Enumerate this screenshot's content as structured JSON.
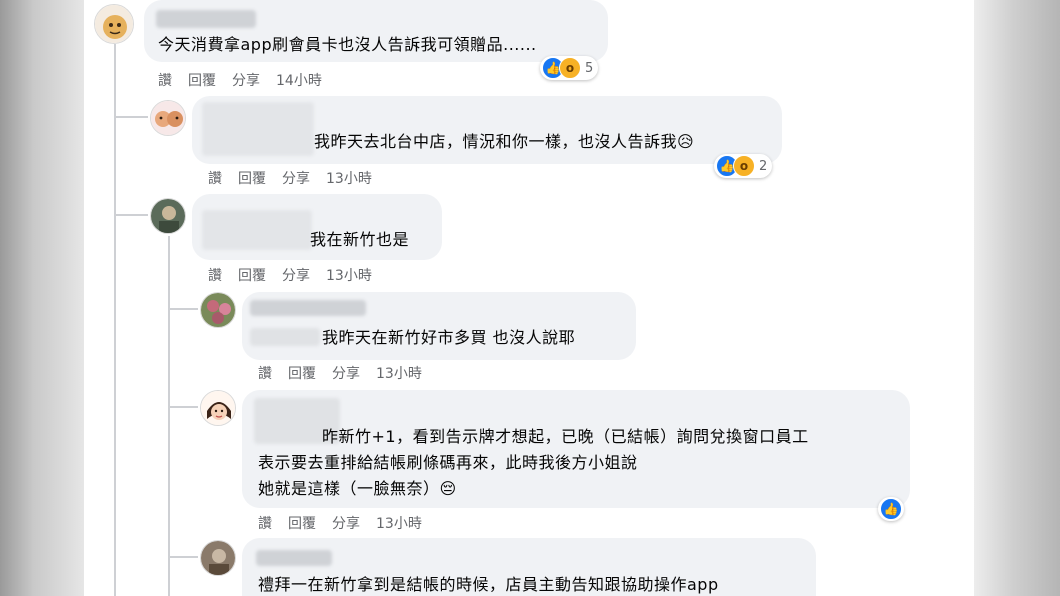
{
  "actions": {
    "like": "讚",
    "reply": "回覆",
    "share": "分享"
  },
  "comments": [
    {
      "text": "今天消費拿app刷會員卡也沒人告訴我可領贈品......",
      "time": "14小時",
      "reaction_count": "5"
    },
    {
      "text": "我昨天去北台中店，情況和你一樣，也沒人告訴我",
      "emoji": "😥",
      "time": "13小時",
      "reaction_count": "2"
    },
    {
      "text": "我在新竹也是",
      "time": "13小時"
    },
    {
      "text": "我昨天在新竹好市多買 也沒人說耶",
      "time": "13小時"
    },
    {
      "lines": [
        "昨新竹+1，看到告示牌才想起，已晚（已結帳）詢問兌換窗口員工",
        "表示要去重排給結帳刷條碼再來，此時我後方小姐說",
        "她就是這樣（一臉無奈）"
      ],
      "emoji": "😔",
      "time": "13小時"
    },
    {
      "text": "禮拜一在新竹拿到是結帳的時候，店員主動告知跟協助操作app"
    }
  ],
  "colors": {
    "like": "#1877f2",
    "wow": "#f7b125",
    "bubble": "#f0f2f5",
    "meta": "#65676b"
  }
}
